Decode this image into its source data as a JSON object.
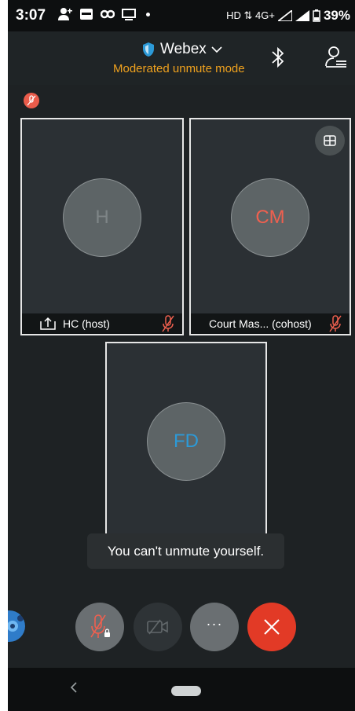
{
  "status_bar": {
    "time": "3:07",
    "network": "HD ⇅ 4G+",
    "battery": "39%"
  },
  "header": {
    "app_title": "Webex",
    "mode_subtitle": "Moderated unmute mode",
    "subtitle_color": "#f0a21e"
  },
  "participants": [
    {
      "initials": "H",
      "name": "HC (host)",
      "initials_color": "#7e8587",
      "muted": true
    },
    {
      "initials": "CM",
      "name": "Court Mas... (cohost)",
      "initials_color": "#f0604f",
      "muted": true
    },
    {
      "initials": "FD",
      "name": "",
      "initials_color": "#2c9ad8",
      "muted": false
    }
  ],
  "toast": {
    "message": "You can't unmute yourself."
  },
  "controls": {
    "more_label": "···",
    "end_color": "#e23a26",
    "mute_locked_color": "#6a6f72",
    "video_off_color": "#2e3336"
  },
  "icons": [
    "shield-icon",
    "chevron-down-icon",
    "bluetooth-icon",
    "participants-icon",
    "share-screen-icon",
    "mic-off-icon",
    "layout-grid-icon",
    "camera-off-icon",
    "close-icon"
  ]
}
